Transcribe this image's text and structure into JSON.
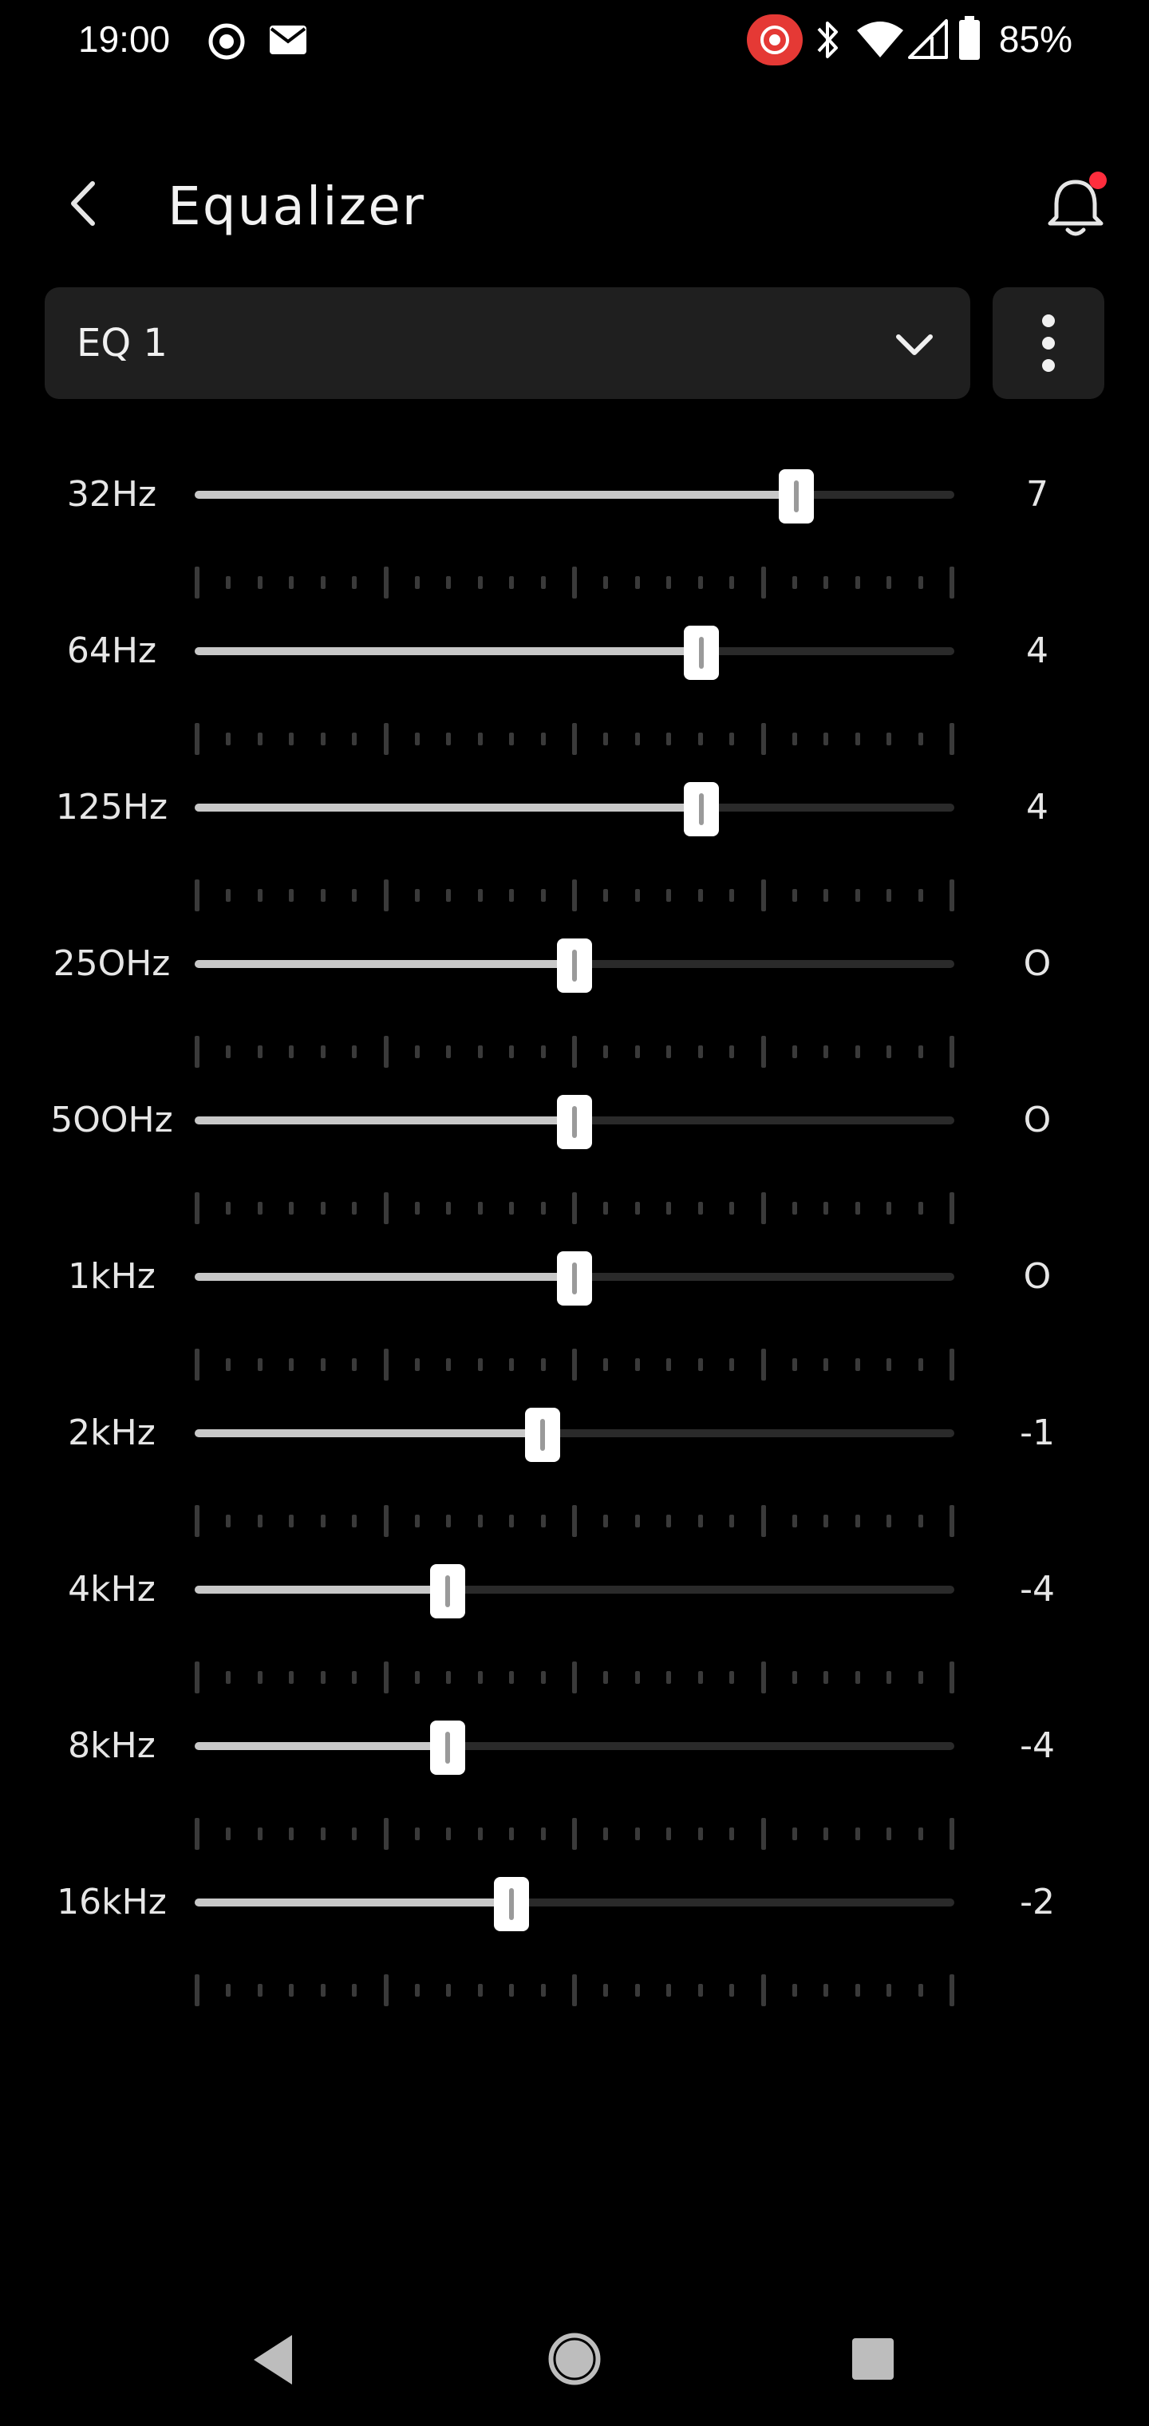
{
  "status_bar": {
    "time": "19:00",
    "left_icons": [
      "screen-record-icon",
      "gmail-icon"
    ],
    "right_icons": [
      "cast-recording-icon",
      "bluetooth-icon",
      "wifi-icon",
      "cellular-signal-icon",
      "battery-icon"
    ],
    "battery": "85%",
    "record_badge_color": "#e53935"
  },
  "header": {
    "title": "Equalizer",
    "notification_dot_color": "#ff2d3d"
  },
  "preset": {
    "selected": "EQ 1"
  },
  "eq": {
    "range": [
      -12,
      12
    ],
    "bands": [
      {
        "label": "32Hz",
        "value": "7",
        "gain": 7
      },
      {
        "label": "64Hz",
        "value": "4",
        "gain": 4
      },
      {
        "label": "125Hz",
        "value": "4",
        "gain": 4
      },
      {
        "label": "25OHz",
        "value": "O",
        "gain": 0
      },
      {
        "label": "5OOHz",
        "value": "O",
        "gain": 0
      },
      {
        "label": "1kHz",
        "value": "O",
        "gain": 0
      },
      {
        "label": "2kHz",
        "value": "-1",
        "gain": -1
      },
      {
        "label": "4kHz",
        "value": "-4",
        "gain": -4
      },
      {
        "label": "8kHz",
        "value": "-4",
        "gain": -4
      },
      {
        "label": "16kHz",
        "value": "-2",
        "gain": -2
      }
    ]
  },
  "nav_bar": {
    "buttons": [
      "back-triangle-icon",
      "home-circle-icon",
      "recents-square-icon"
    ]
  }
}
